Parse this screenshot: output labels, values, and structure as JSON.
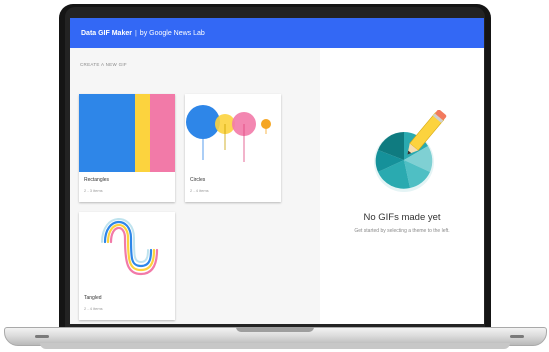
{
  "app": {
    "title": "Data GIF Maker",
    "separator": "|",
    "byline": "by Google News Lab",
    "header_color": "#3368f5"
  },
  "left_pane": {
    "section_label": "CREATE A NEW GIF",
    "cards": [
      {
        "name": "Rectangles",
        "count": "2 - 3 items"
      },
      {
        "name": "Circles",
        "count": "2 - 4 items"
      },
      {
        "name": "Tangled",
        "count": "2 - 4 items"
      }
    ]
  },
  "right_pane": {
    "empty_title": "No GIFs made yet",
    "empty_subtitle": "Get started by selecting a theme to the left."
  },
  "colors": {
    "blue": "#2e86e8",
    "yellow": "#fcd33e",
    "pink": "#f27aa8",
    "orange": "#f5a623",
    "teal_dark": "#0f7b80",
    "teal_mid": "#2aaab0",
    "teal_light": "#7fd0d3"
  },
  "icons": [
    "pie-chart-icon",
    "pencil-icon"
  ]
}
